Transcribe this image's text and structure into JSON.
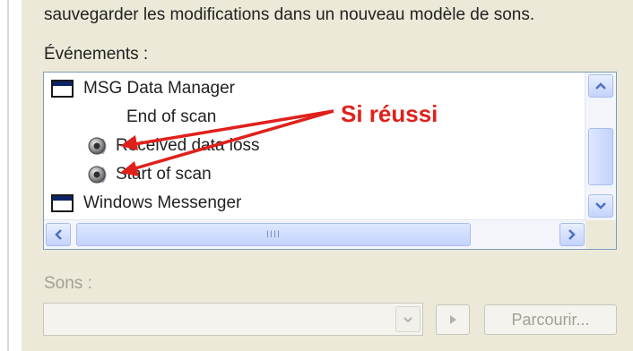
{
  "description_text": "sauvegarder les modifications dans un nouveau modèle de sons.",
  "events": {
    "label": "Événements :",
    "items": [
      {
        "label": "MSG Data Manager",
        "icon": "window-icon"
      },
      {
        "label": "End of scan",
        "icon": "none"
      },
      {
        "label": "Received data loss",
        "icon": "speaker-icon"
      },
      {
        "label": "Start of scan",
        "icon": "speaker-icon"
      },
      {
        "label": "Windows Messenger",
        "icon": "window-icon"
      }
    ],
    "horizontal_scroll_grip": "IIII"
  },
  "annotation": {
    "text": "Si réussi",
    "color": "#e0201b"
  },
  "sounds": {
    "label": "Sons :",
    "selected_value": "",
    "browse_label": "Parcourir..."
  },
  "colors": {
    "panel": "#ece9d8",
    "list_border": "#7f9db9",
    "scroll_accent": "#4d6fc7",
    "disabled_text": "#a3a094"
  }
}
